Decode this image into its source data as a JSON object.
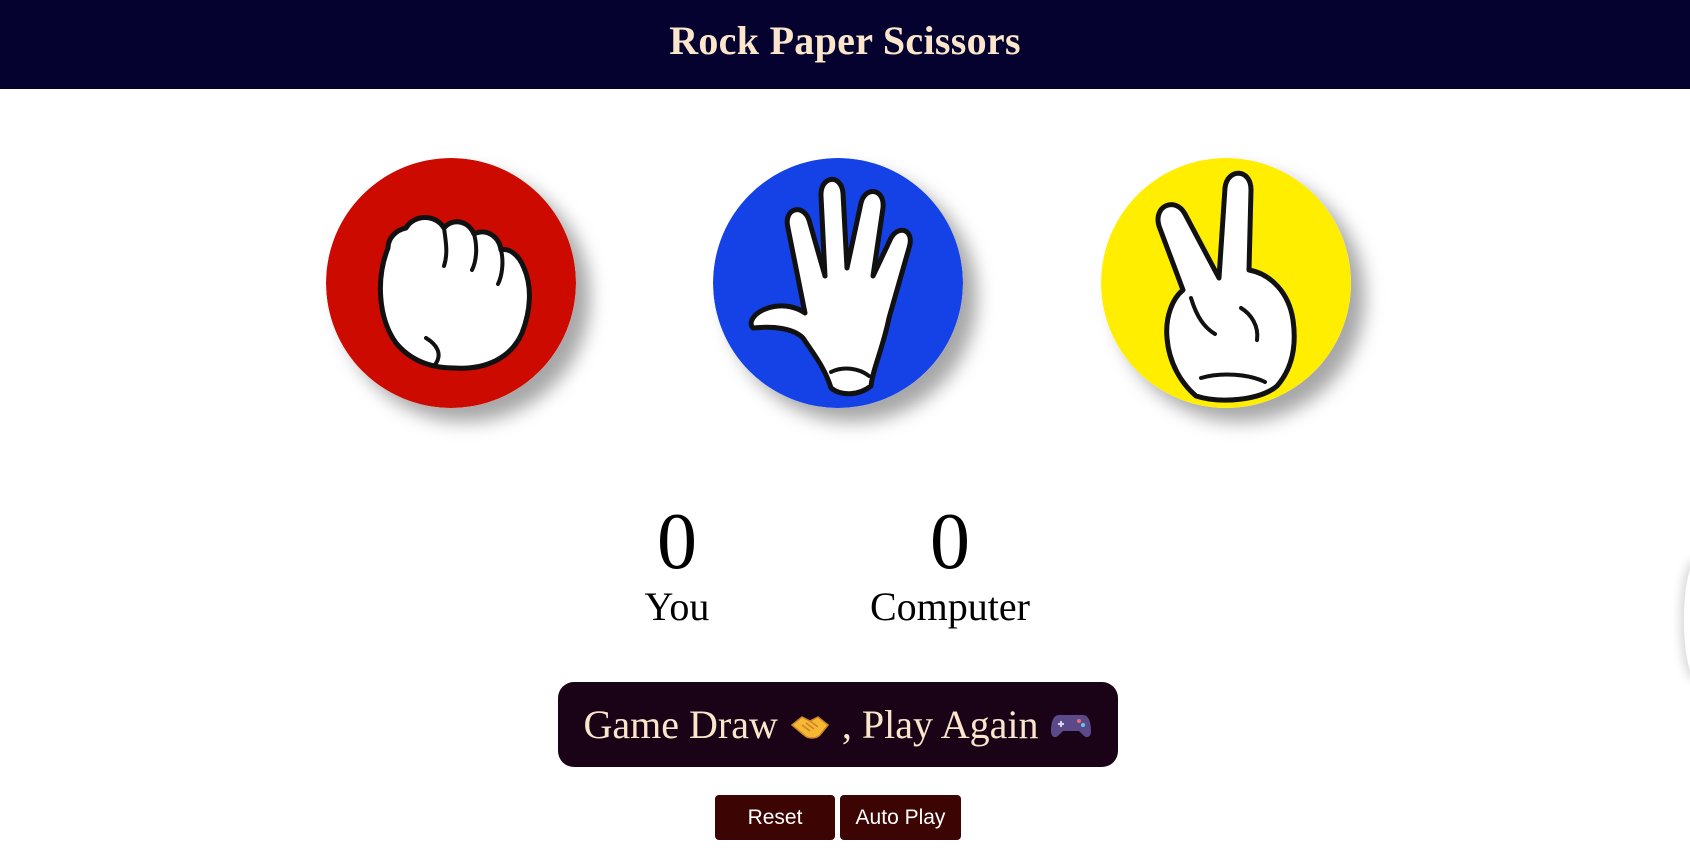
{
  "header": {
    "title": "Rock Paper Scissors"
  },
  "choices": [
    {
      "id": "rock",
      "icon": "rock-hand-icon",
      "color": "#cc0a00"
    },
    {
      "id": "paper",
      "icon": "paper-hand-icon",
      "color": "#1442e6"
    },
    {
      "id": "scissors",
      "icon": "scissors-hand-icon",
      "color": "#ffee00"
    }
  ],
  "score": {
    "you": {
      "value": "0",
      "label": "You"
    },
    "computer": {
      "value": "0",
      "label": "Computer"
    }
  },
  "result": {
    "text_before": "Game Draw",
    "emoji_1": "handshake-icon",
    "text_after": ", Play Again",
    "emoji_2": "game-controller-icon"
  },
  "buttons": {
    "reset_label": "Reset",
    "autoplay_label": "Auto Play"
  },
  "colors": {
    "header_bg": "#05022f",
    "header_text": "#fbe6cb",
    "result_bg": "#1b0317",
    "button_bg": "#3d0404"
  }
}
